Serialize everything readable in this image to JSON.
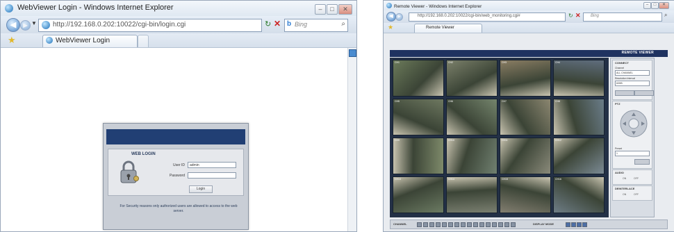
{
  "login_window": {
    "title": "WebViewer Login - Windows Internet Explorer",
    "url": "http://192.168.0.202:10022/cgi-bin/login.cgi",
    "search_placeholder": "Bing",
    "tab_label": "WebViewer Login",
    "dialog": {
      "heading": "WEB LOGIN",
      "user_id_label": "User ID",
      "user_id_value": "admin",
      "password_label": "Password",
      "login_button": "Login",
      "notice": "For Security reasons only authorized users are allowed to access to the web server."
    }
  },
  "viewer_window": {
    "title": "Remote Viewer - Windows Internet Explorer",
    "url": "http://192.168.0.202:10022/cgi-bin/web_monitoring.cgi#",
    "search_placeholder": "Bing",
    "tab_label": "Remote Viewer",
    "top_nav_label": "REMOTE VIEWER",
    "panel": {
      "connect_title": "CONNECT",
      "channel_label": "Channel",
      "channel_value": "ALL CHANNEL",
      "refresh_label": "Resolution Interval",
      "refresh_value": "60HB",
      "ptz_title": "PTZ",
      "preset_label": "Preset",
      "preset_value": "1",
      "audio_title": "AUDIO",
      "deinterlace_title": "DEINTERLACE",
      "on_label": "ON",
      "off_label": "OFF"
    },
    "bottom": {
      "channel_label": "CHANNEL",
      "display_mode_label": "DISPLAY MODE"
    },
    "cameras": [
      "CH1",
      "CH2",
      "CH3",
      "CH4",
      "CH5",
      "CH6",
      "CH7",
      "CH8",
      "CH9",
      "CH10",
      "CH11",
      "CH12",
      "CH13",
      "CH14",
      "CH15",
      "CH16"
    ]
  }
}
